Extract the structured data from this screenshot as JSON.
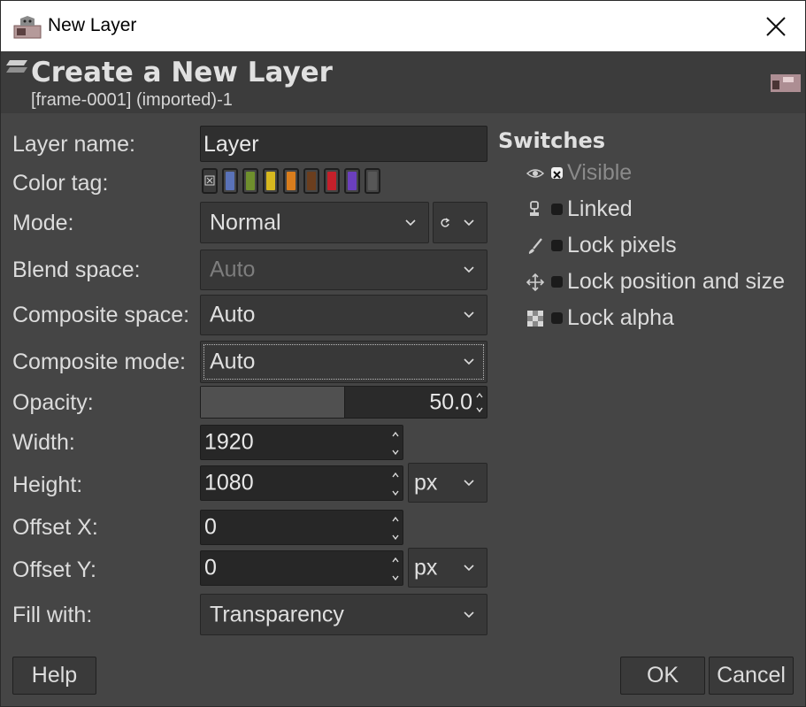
{
  "window": {
    "title": "New Layer"
  },
  "header": {
    "title": "Create a New Layer",
    "subtitle": "[frame-0001] (imported)-1"
  },
  "form": {
    "layer_name": {
      "label": "Layer name:",
      "value": "Layer"
    },
    "color_tag": {
      "label": "Color tag:",
      "options": [
        "none",
        "blue",
        "green",
        "yellow",
        "orange",
        "brown",
        "red",
        "violet",
        "gray"
      ]
    },
    "mode": {
      "label": "Mode:",
      "value": "Normal"
    },
    "blend_space": {
      "label": "Blend space:",
      "value": "Auto"
    },
    "composite_space": {
      "label": "Composite space:",
      "value": "Auto"
    },
    "composite_mode": {
      "label": "Composite mode:",
      "value": "Auto"
    },
    "opacity": {
      "label": "Opacity:",
      "value": "50.0",
      "fraction": 0.5
    },
    "width": {
      "label": "Width:",
      "value": "1920"
    },
    "height": {
      "label": "Height:",
      "value": "1080",
      "unit": "px"
    },
    "offset_x": {
      "label": "Offset X:",
      "value": "0"
    },
    "offset_y": {
      "label": "Offset Y:",
      "value": "0",
      "unit": "px"
    },
    "fill_with": {
      "label": "Fill with:",
      "value": "Transparency"
    }
  },
  "switches": {
    "title": "Switches",
    "items": [
      {
        "label": "Visible",
        "checked": true,
        "icon": "eye-icon"
      },
      {
        "label": "Linked",
        "checked": false,
        "icon": "chain-icon"
      },
      {
        "label": "Lock pixels",
        "checked": false,
        "icon": "brush-icon"
      },
      {
        "label": "Lock position and size",
        "checked": false,
        "icon": "move-icon"
      },
      {
        "label": "Lock alpha",
        "checked": false,
        "icon": "checkerboard-icon"
      }
    ]
  },
  "buttons": {
    "help": "Help",
    "ok": "OK",
    "cancel": "Cancel"
  },
  "colors": {
    "tag_blue": "#5a72b8",
    "tag_green": "#6f8f2d",
    "tag_yellow": "#d7b81f",
    "tag_orange": "#d97d1d",
    "tag_brown": "#6b3e1e",
    "tag_red": "#c3202a",
    "tag_violet": "#6b3fbd",
    "tag_gray": "#575757"
  }
}
